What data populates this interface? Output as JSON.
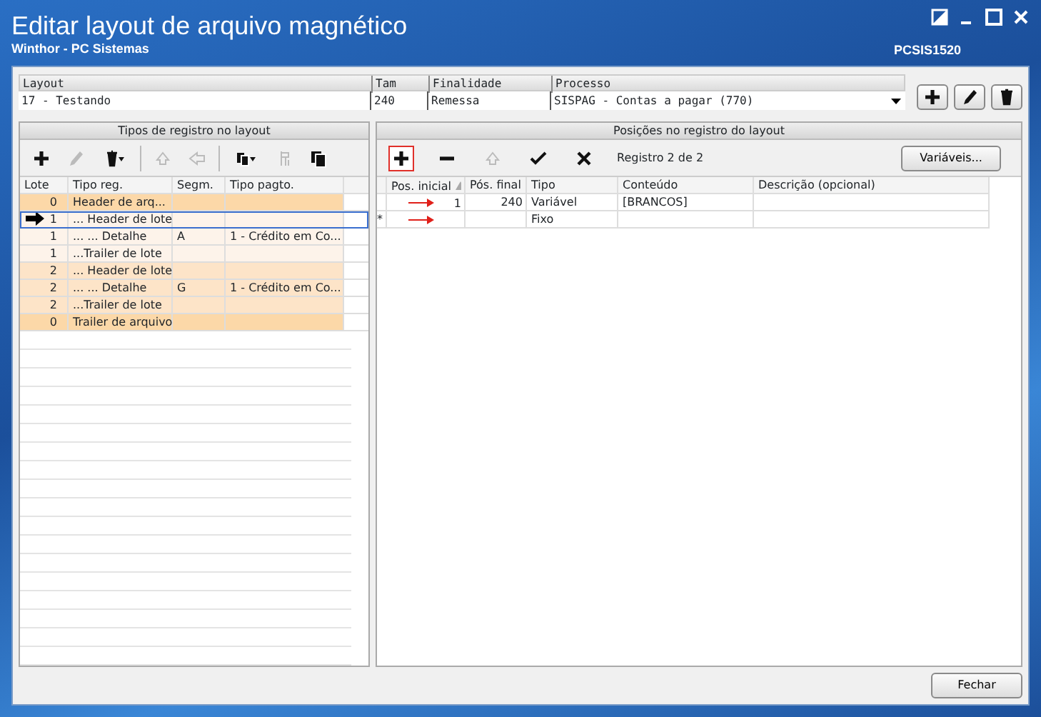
{
  "window": {
    "title": "Editar layout de arquivo magnético",
    "subtitle": "Winthor - PC Sistemas",
    "code": "PCSIS1520"
  },
  "layout_selector": {
    "columns": [
      "Layout",
      "Tam",
      "Finalidade",
      "Processo"
    ],
    "values": [
      "17 - Testando",
      "240",
      "Remessa",
      "SISPAG - Contas a pagar (770)"
    ]
  },
  "layout_buttons": [
    {
      "kind": "add"
    },
    {
      "kind": "edit"
    },
    {
      "kind": "delete"
    }
  ],
  "left_panel": {
    "title": "Tipos de registro no layout",
    "tools": [
      {
        "kind": "add",
        "disabled": false
      },
      {
        "kind": "edit",
        "disabled": true
      },
      {
        "kind": "delete-menu",
        "disabled": false
      },
      {
        "kind": "up",
        "disabled": true
      },
      {
        "kind": "left",
        "disabled": true
      },
      {
        "kind": "copy-menu",
        "disabled": false
      },
      {
        "kind": "move",
        "disabled": true
      },
      {
        "kind": "paste",
        "disabled": false
      }
    ],
    "columns": [
      "Lote",
      "Tipo reg.",
      "Segm.",
      "Tipo pagto."
    ],
    "rows": [
      {
        "cells": [
          "0",
          "Header de arq...",
          "",
          ""
        ],
        "color": "#fcd8a8",
        "selected": false
      },
      {
        "cells": [
          "1",
          "... Header de lote",
          "",
          ""
        ],
        "color": "#fdf3ea",
        "selected": true
      },
      {
        "cells": [
          "1",
          "... ... Detalhe",
          "A",
          "1 - Crédito em Co..."
        ],
        "color": "#fdf3ea",
        "selected": false
      },
      {
        "cells": [
          "1",
          "...Trailer de lote",
          "",
          ""
        ],
        "color": "#fdf3ea",
        "selected": false
      },
      {
        "cells": [
          "2",
          "... Header de lote",
          "",
          ""
        ],
        "color": "#fde4c8",
        "selected": false
      },
      {
        "cells": [
          "2",
          "... ... Detalhe",
          "G",
          "1 - Crédito em Co..."
        ],
        "color": "#fde4c8",
        "selected": false
      },
      {
        "cells": [
          "2",
          "...Trailer de lote",
          "",
          ""
        ],
        "color": "#fde4c8",
        "selected": false
      },
      {
        "cells": [
          "0",
          "Trailer de arquivo",
          "",
          ""
        ],
        "color": "#fcd8a8",
        "selected": false
      }
    ]
  },
  "right_panel": {
    "title": "Posições no registro do layout",
    "tools": [
      {
        "kind": "add",
        "disabled": false,
        "selected": true
      },
      {
        "kind": "remove",
        "disabled": false,
        "selected": false
      },
      {
        "kind": "up",
        "disabled": true,
        "selected": false
      },
      {
        "kind": "confirm",
        "disabled": false,
        "selected": false
      },
      {
        "kind": "cancel",
        "disabled": false,
        "selected": false
      }
    ],
    "record_counter": "Registro 2 de 2",
    "variables_button": "Variáveis...",
    "columns": [
      "Pos. inicial",
      "Pós. final",
      "Tipo",
      "Conteúdo",
      "Descrição (opcional)"
    ],
    "rows": [
      {
        "kind": "data",
        "cells": [
          "1",
          "240",
          "Variável",
          "[BRANCOS]",
          ""
        ]
      },
      {
        "kind": "new",
        "marker": "*",
        "cells": [
          "",
          "",
          "Fixo",
          "",
          ""
        ]
      }
    ]
  },
  "close_button": "Fechar"
}
